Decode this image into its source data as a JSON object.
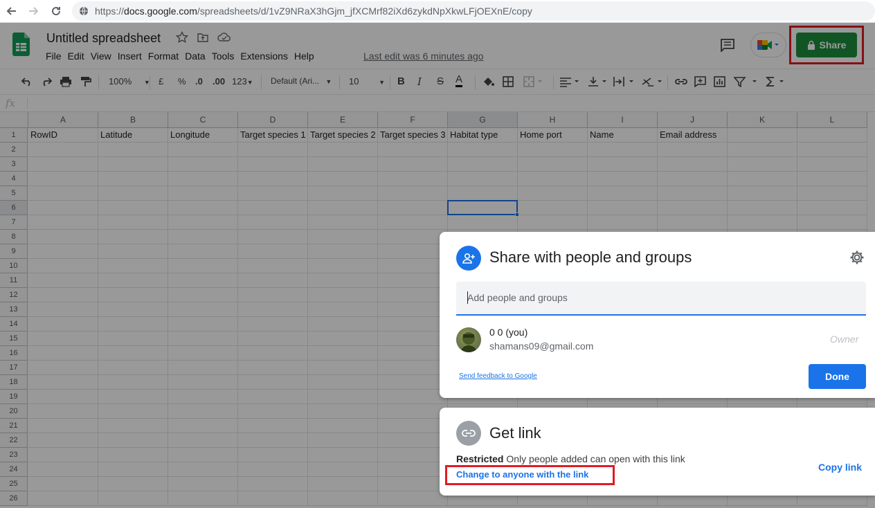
{
  "browser": {
    "url_prefix": "https://",
    "url_domain": "docs.google.com",
    "url_path": "/spreadsheets/d/1vZ9NRaX3hGjm_jfXCMrf82iXd6zykdNpXkwLFjOEXnE/copy"
  },
  "header": {
    "title": "Untitled spreadsheet",
    "menu": [
      "File",
      "Edit",
      "View",
      "Insert",
      "Format",
      "Data",
      "Tools",
      "Extensions",
      "Help"
    ],
    "last_edit": "Last edit was 6 minutes ago",
    "share_label": "Share"
  },
  "toolbar": {
    "zoom": "100%",
    "currency": "£",
    "percent": "%",
    "dec_less": ".0",
    "dec_more": ".00",
    "more_formats": "123",
    "font": "Default (Ari...",
    "font_size": "10",
    "bold": "B",
    "italic": "I",
    "strike": "S",
    "text_color": "A"
  },
  "formula": {
    "fx": "fx"
  },
  "grid": {
    "columns": [
      "A",
      "B",
      "C",
      "D",
      "E",
      "F",
      "G",
      "H",
      "I",
      "J",
      "K",
      "L"
    ],
    "rows": [
      "1",
      "2",
      "3",
      "4",
      "5",
      "6",
      "7",
      "8",
      "9",
      "10",
      "11",
      "12",
      "13",
      "14",
      "15",
      "16",
      "17",
      "18",
      "19",
      "20",
      "21",
      "22",
      "23",
      "24",
      "25",
      "26"
    ],
    "row1": [
      "RowID",
      "Latitude",
      "Longitude",
      "Target species 1",
      "Target species 2",
      "Target species 3",
      "Habitat type",
      "Home port",
      "Name",
      "Email address",
      "",
      ""
    ]
  },
  "share_dialog": {
    "title": "Share with people and groups",
    "input_placeholder": "Add people and groups",
    "user_name": "0 0 (you)",
    "user_email": "shamans09@gmail.com",
    "role": "Owner",
    "feedback": "Send feedback to Google",
    "done": "Done"
  },
  "link_dialog": {
    "title": "Get link",
    "restricted_label": "Restricted",
    "restricted_desc": " Only people added can open with this link",
    "change_link": "Change to anyone with the link",
    "copy_link": "Copy link"
  },
  "colors": {
    "share_green": "#1e8e3e",
    "accent_blue": "#1a73e8",
    "highlight_red": "#e01b24"
  }
}
